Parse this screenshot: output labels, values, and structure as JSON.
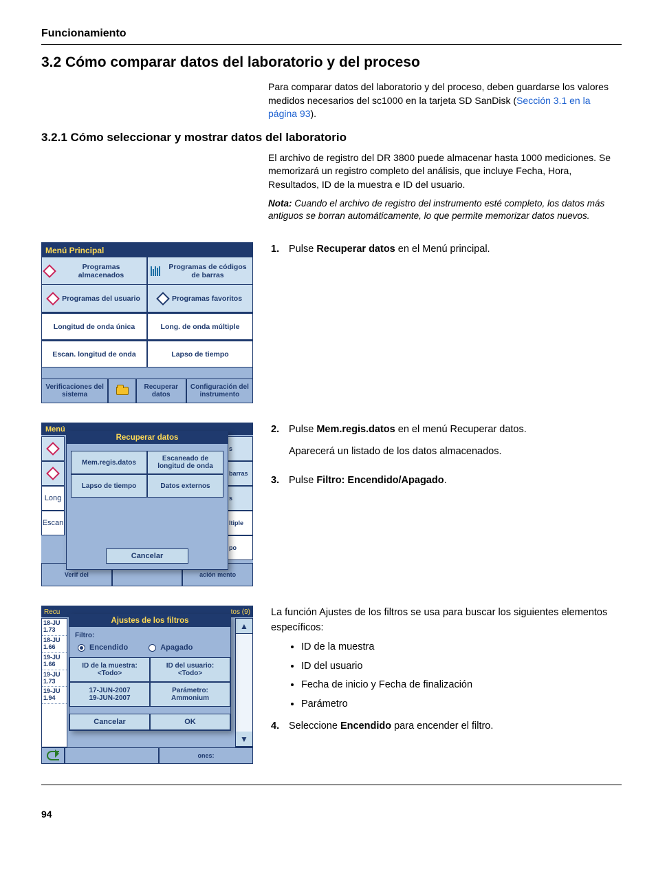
{
  "page": {
    "running_head": "Funcionamiento",
    "section_title": "3.2  Cómo comparar datos del laboratorio y del proceso",
    "intro_p1": "Para comparar datos del laboratorio y del proceso, deben guardarse los valores medidos necesarios del sc1000 en la tarjeta SD SanDisk (",
    "intro_link": "Sección 3.1 en la página 93",
    "intro_p1_tail": ").",
    "subsection_title": "3.2.1  Cómo seleccionar y mostrar datos del laboratorio",
    "sub_p1": "El archivo de registro del DR 3800 puede almacenar hasta 1000 mediciones. Se memorizará un registro completo del análisis, que incluye Fecha, Hora, Resultados, ID de la muestra e ID del usuario.",
    "note_label": "Nota:",
    "note_body": "Cuando el archivo de registro del instrumento esté completo, los datos más antiguos se borran automáticamente, lo que permite memorizar datos nuevos.",
    "page_number": "94"
  },
  "step1": {
    "num": "1.",
    "text_a": "Pulse ",
    "bold": "Recuperar datos",
    "text_b": " en el Menú principal."
  },
  "step2": {
    "num": "2.",
    "text_a": "Pulse ",
    "bold": "Mem.regis.datos",
    "text_b": " en el menú Recuperar datos.",
    "p2": "Aparecerá un listado de los datos almacenados."
  },
  "step3": {
    "num": "3.",
    "text_a": "Pulse ",
    "bold": "Filtro: Encendido/Apagado",
    "text_b": "."
  },
  "filters": {
    "lead": "La función Ajustes de los filtros se usa para buscar los siguientes elementos específicos:",
    "b1": "ID de la muestra",
    "b2": "ID del usuario",
    "b3": "Fecha de inicio y Fecha de finalización",
    "b4": "Parámetro"
  },
  "step4": {
    "num": "4.",
    "text_a": "Seleccione ",
    "bold": "Encendido",
    "text_b": " para encender el filtro."
  },
  "shot1": {
    "title": "Menú Principal",
    "c1": "Programas almacenados",
    "c2": "Programas de códigos de barras",
    "c3": "Programas del usuario",
    "c4": "Programas favoritos",
    "c5": "Longitud de onda única",
    "c6": "Long. de onda múltiple",
    "c7": "Escan. longitud de onda",
    "c8": "Lapso de tiempo",
    "f1": "Verificaciones del sistema",
    "f3": "Recuperar datos",
    "f4": "Configuración del instrumento"
  },
  "shot2": {
    "bg_title": "Menú",
    "bg_r1": "s",
    "bg_r2": "barras",
    "bg_r3": "s",
    "bg_r5": "ltiple",
    "bg_r6": "po",
    "bg_b1": "Verif del",
    "bg_b2": "ación mento",
    "bg_l1": "Long",
    "bg_l2": "Escan",
    "dialog_title": "Recuperar datos",
    "b1": "Mem.regis.datos",
    "b2": "Escaneado de longitud de onda",
    "b3": "Lapso de tiempo",
    "b4": "Datos externos",
    "cancel": "Cancelar"
  },
  "shot3": {
    "bar_left": "Recu",
    "bar_right": "tos (9)",
    "list": [
      "18-JU 1.73",
      "18-JU 1.66",
      "19-JU 1.66",
      "19-JU 1.73",
      "19-JU 1.94"
    ],
    "dialog_title": "Ajustes de los filtros",
    "filtro_lbl": "Filtro:",
    "on": "Encendido",
    "off": "Apagado",
    "id_muestra_lbl": "ID de la muestra:",
    "id_muestra_val": "<Todo>",
    "id_usuario_lbl": "ID del usuario:",
    "id_usuario_val": "<Todo>",
    "fecha1": "17-JUN-2007",
    "fecha2": "19-JUN-2007",
    "param_lbl": "Parámetro:",
    "param_val": "Ammonium",
    "cancel": "Cancelar",
    "ok": "OK",
    "footer_right": "ones:"
  }
}
